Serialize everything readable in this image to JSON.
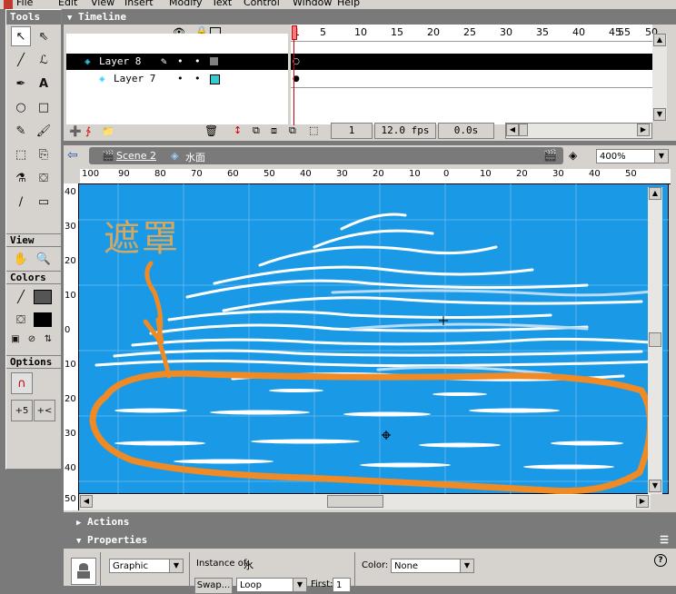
{
  "menubar": {
    "items": [
      "File",
      "Edit",
      "View",
      "Insert",
      "Modify",
      "Text",
      "Control",
      "Window",
      "Help"
    ]
  },
  "tools": {
    "title": "Tools",
    "view_title": "View",
    "colors_title": "Colors",
    "options_title": "Options"
  },
  "timeline": {
    "title": "Timeline",
    "frame_numbers": [
      "1",
      "5",
      "10",
      "15",
      "20",
      "25",
      "30",
      "35",
      "40",
      "45",
      "50",
      "55"
    ],
    "layers": [
      {
        "name": "Layer 8",
        "active": true,
        "outline_color": "#808080"
      },
      {
        "name": "Layer 7",
        "active": false,
        "outline_color": "#33cccc"
      }
    ],
    "current_frame": "1",
    "fps": "12.0 fps",
    "elapsed": "0.0s"
  },
  "scenebar": {
    "scene": "Scene 2",
    "symbol": "水面",
    "zoom": "400%"
  },
  "rulers": {
    "h_ticks": [
      "100",
      "90",
      "80",
      "70",
      "60",
      "50",
      "40",
      "30",
      "20",
      "10",
      "0",
      "10",
      "20",
      "30",
      "40",
      "50"
    ],
    "v_ticks": [
      "40",
      "30",
      "20",
      "10",
      "0",
      "10",
      "20",
      "30",
      "40",
      "50"
    ]
  },
  "canvas": {
    "annotation": "遮罩",
    "bg_color": "#1a9ae6",
    "mark_color": "#f08a24"
  },
  "actions": {
    "title": "Actions"
  },
  "properties": {
    "title": "Properties",
    "symbol_type": "Graphic",
    "instance_label": "Instance of:",
    "instance_value": "水",
    "swap_label": "Swap...",
    "loop_value": "Loop",
    "first_label": "First:",
    "first_value": "1",
    "color_label": "Color:",
    "color_value": "None"
  }
}
